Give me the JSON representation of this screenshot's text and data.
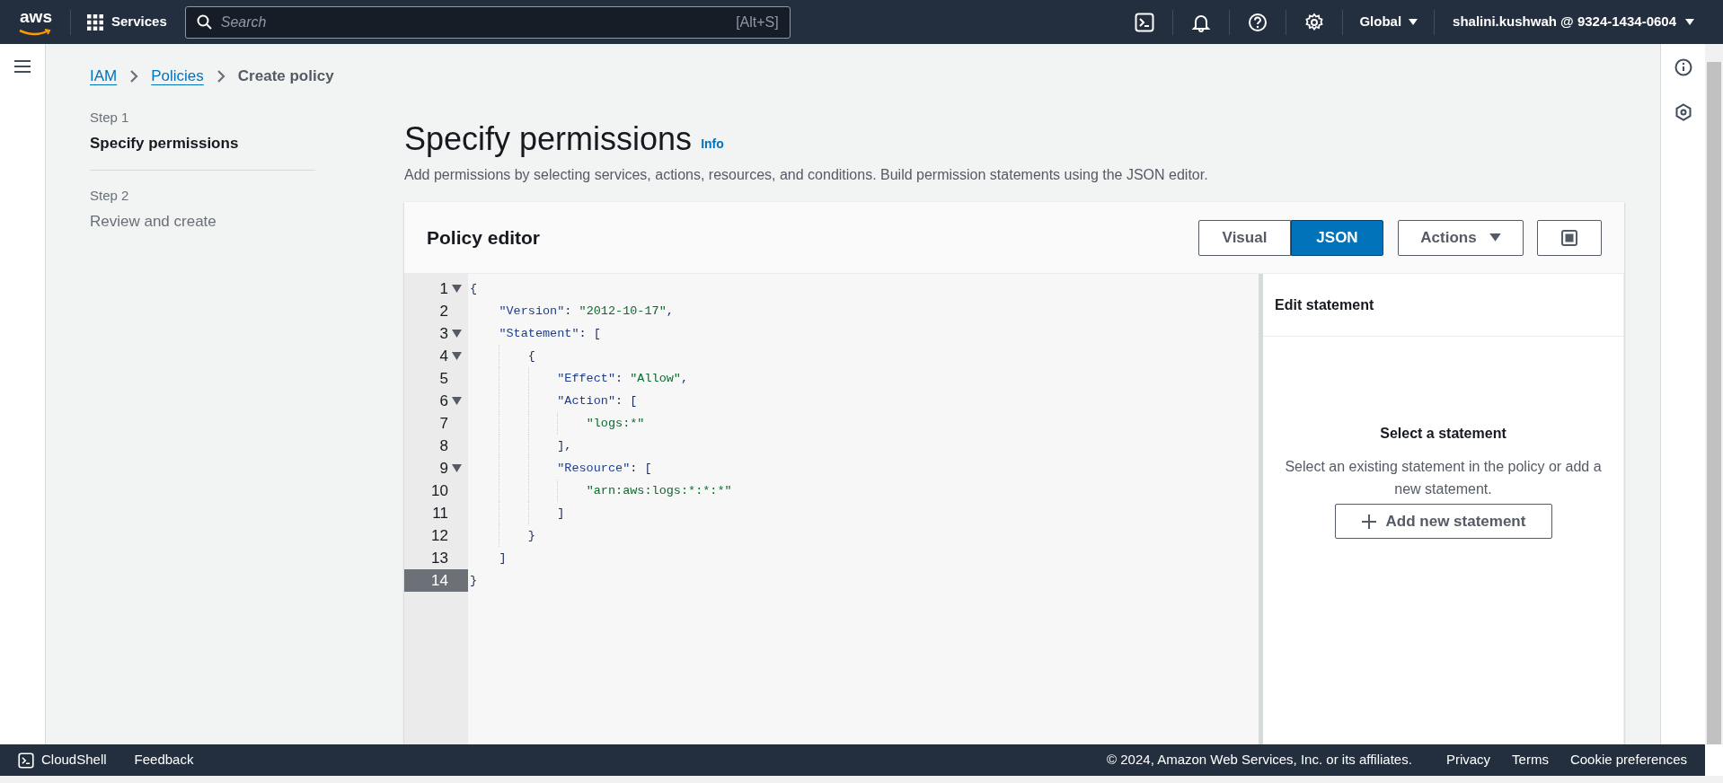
{
  "top_bar": {
    "logo": "aws",
    "services": "Services",
    "search": {
      "placeholder": "Search",
      "shortcut": "[Alt+S]"
    },
    "region": "Global",
    "account": "shalini.kushwah @ 9324-1434-0604"
  },
  "breadcrumbs": [
    {
      "label": "IAM",
      "link": true
    },
    {
      "label": "Policies",
      "link": true
    },
    {
      "label": "Create policy",
      "link": false
    }
  ],
  "steps": [
    {
      "step": "Step 1",
      "title": "Specify permissions",
      "selected": true
    },
    {
      "step": "Step 2",
      "title": "Review and create",
      "selected": false
    }
  ],
  "page": {
    "title": "Specify permissions",
    "info": "Info",
    "description": "Add permissions by selecting services, actions, resources, and conditions. Build permission statements using the JSON editor."
  },
  "editor": {
    "title": "Policy editor",
    "mode_tabs": [
      {
        "label": "Visual",
        "selected": false
      },
      {
        "label": "JSON",
        "selected": true
      }
    ],
    "actions": "Actions",
    "lines": [
      {
        "number": "1",
        "text": "{",
        "foldable": true,
        "active": false
      },
      {
        "number": "2",
        "text": "    \"Version\": \"2012-10-17\",",
        "foldable": false,
        "active": false
      },
      {
        "number": "3",
        "text": "    \"Statement\": [",
        "foldable": true,
        "active": false
      },
      {
        "number": "4",
        "text": "        {",
        "foldable": true,
        "active": false
      },
      {
        "number": "5",
        "text": "            \"Effect\": \"Allow\",",
        "foldable": false,
        "active": false
      },
      {
        "number": "6",
        "text": "            \"Action\": [",
        "foldable": true,
        "active": false
      },
      {
        "number": "7",
        "text": "                \"logs:*\"",
        "foldable": false,
        "active": false
      },
      {
        "number": "8",
        "text": "            ],",
        "foldable": false,
        "active": false
      },
      {
        "number": "9",
        "text": "            \"Resource\": [",
        "foldable": true,
        "active": false
      },
      {
        "number": "10",
        "text": "                \"arn:aws:logs:*:*:*\"",
        "foldable": false,
        "active": false
      },
      {
        "number": "11",
        "text": "            ]",
        "foldable": false,
        "active": false
      },
      {
        "number": "12",
        "text": "        }",
        "foldable": false,
        "active": false
      },
      {
        "number": "13",
        "text": "    ]",
        "foldable": false,
        "active": false
      },
      {
        "number": "14",
        "text": "}",
        "foldable": false,
        "active": true
      }
    ],
    "side_panel": {
      "title": "Edit statement",
      "empty_title": "Select a statement",
      "empty_text": "Select an existing statement in the policy or add a new statement.",
      "add_button": "Add new statement"
    }
  },
  "footer": {
    "left": [
      "CloudShell",
      "Feedback"
    ],
    "copyright": "© 2024, Amazon Web Services, Inc. or its affiliates.",
    "links": [
      "Privacy",
      "Terms",
      "Cookie preferences"
    ]
  }
}
